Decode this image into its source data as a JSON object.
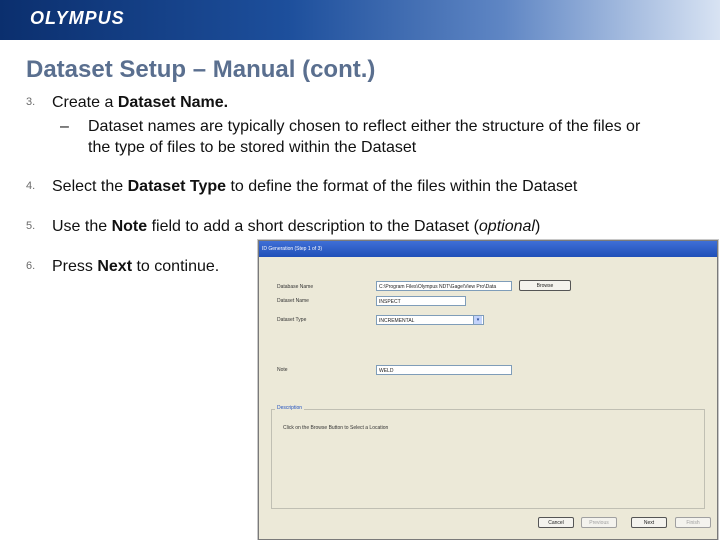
{
  "header": {
    "logo": "OLYMPUS"
  },
  "slide": {
    "title": "Dataset Setup – Manual (cont.)",
    "items": [
      {
        "num": "3.",
        "parts": [
          "Create a ",
          "Dataset Name."
        ],
        "sub": "Dataset names are typically chosen to reflect either the structure of the files or the type of files to be stored within the Dataset"
      },
      {
        "num": "4.",
        "parts": [
          "Select the ",
          "Dataset Type",
          " to define the format of the files within the Dataset"
        ]
      },
      {
        "num": "5.",
        "parts": [
          "Use the ",
          "Note",
          " field to add a short description to the Dataset (",
          "optional",
          ")"
        ]
      },
      {
        "num": "6.",
        "parts": [
          "Press ",
          "Next",
          " to continue."
        ]
      }
    ],
    "sub_dash": "–"
  },
  "dialog": {
    "title": "ID Generation (Step 1 of 3)",
    "database_label": "Database Name",
    "database_value": "C:\\Program Files\\Olympus NDT\\Gage\\View Pro\\Data",
    "browse_label": "Browse",
    "dataset_name_label": "Dataset Name",
    "dataset_name_value": "INSPECT",
    "dataset_type_label": "Dataset Type",
    "dataset_type_value": "INCREMENTAL",
    "note_label": "Note",
    "note_value": "WELD",
    "description_legend": "Description",
    "description_text": "Click on the Browse Button to Select a Location",
    "buttons": {
      "cancel": "Cancel",
      "previous": "Previous",
      "next": "Next",
      "finish": "Finish"
    }
  }
}
